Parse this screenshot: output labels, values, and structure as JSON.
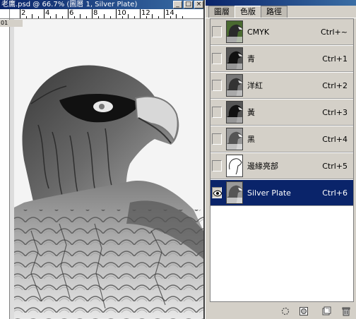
{
  "document": {
    "title": "老鷹.psd @ 66.7% (圖層 1, Silver Plate)",
    "layer_tag": "01 ",
    "ruler_numbers": [
      "2",
      "4",
      "6",
      "8",
      "10",
      "12",
      "14"
    ],
    "min_label": "_",
    "max_label": "□",
    "close_label": "×"
  },
  "panel": {
    "tabs": [
      {
        "label": "圖層",
        "active": false
      },
      {
        "label": "色版",
        "active": true
      },
      {
        "label": "路徑",
        "active": false
      }
    ],
    "channels": [
      {
        "name": "CMYK",
        "shortcut": "Ctrl+~",
        "visible": false,
        "selected": false,
        "thumb": "color"
      },
      {
        "name": "青",
        "shortcut": "Ctrl+1",
        "visible": false,
        "selected": false,
        "thumb": "gray-dark"
      },
      {
        "name": "洋紅",
        "shortcut": "Ctrl+2",
        "visible": false,
        "selected": false,
        "thumb": "gray-mid"
      },
      {
        "name": "黃",
        "shortcut": "Ctrl+3",
        "visible": false,
        "selected": false,
        "thumb": "gray-dark"
      },
      {
        "name": "黑",
        "shortcut": "Ctrl+4",
        "visible": false,
        "selected": false,
        "thumb": "gray-light"
      },
      {
        "name": "邊緣亮部",
        "shortcut": "Ctrl+5",
        "visible": false,
        "selected": false,
        "thumb": "outline"
      },
      {
        "name": "Silver Plate",
        "shortcut": "Ctrl+6",
        "visible": true,
        "selected": true,
        "thumb": "gray-light"
      }
    ],
    "bottom_icons": [
      "load-selection-icon",
      "save-selection-icon",
      "new-channel-icon",
      "trash-icon"
    ]
  },
  "colors": {
    "selection": "#0a246a",
    "face": "#d4d0c8"
  }
}
